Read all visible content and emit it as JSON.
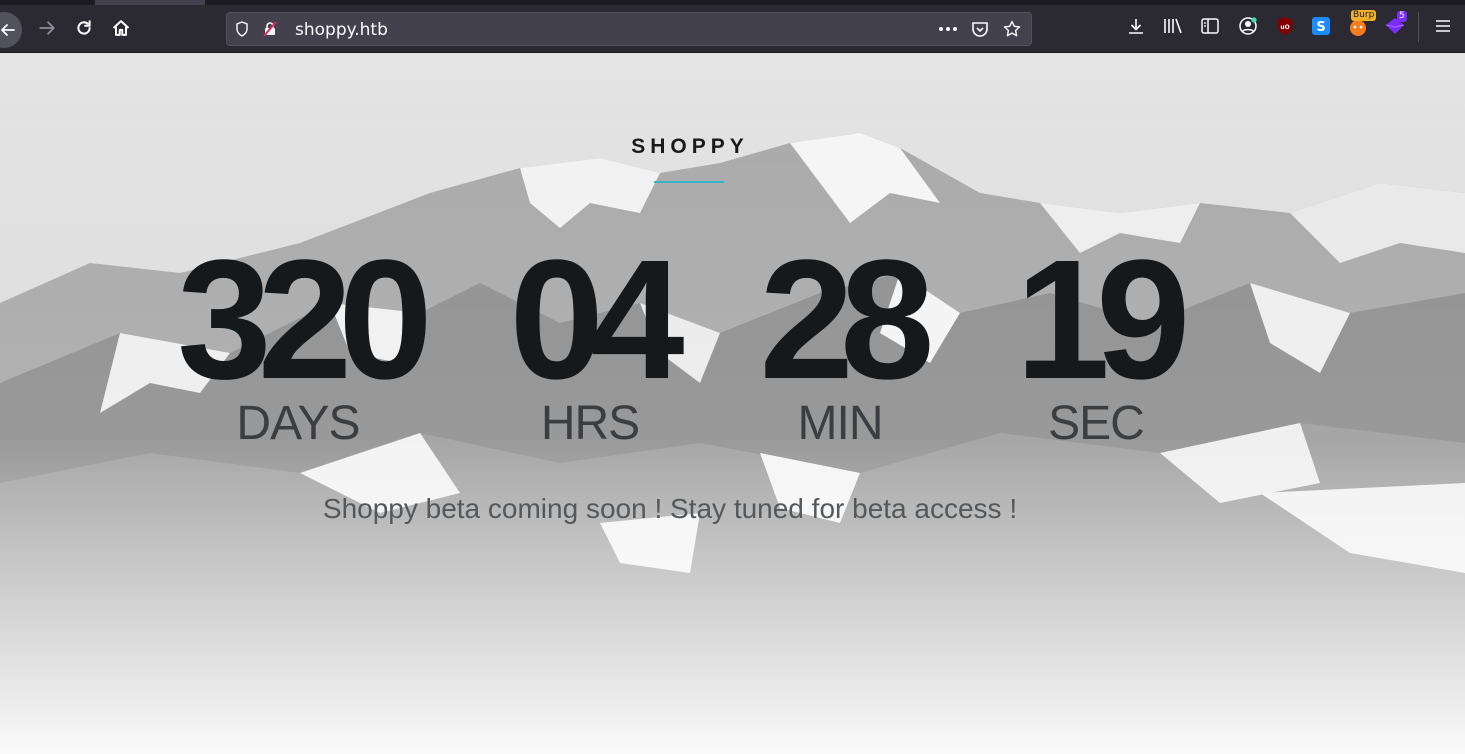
{
  "browser": {
    "url": "shoppy.htb",
    "extensions": {
      "burp_badge": "Burp",
      "notification_count": "5"
    }
  },
  "page": {
    "brand": "SHOPPY",
    "countdown": [
      {
        "value": "320",
        "unit": "DAYS"
      },
      {
        "value": "04",
        "unit": "HRS"
      },
      {
        "value": "28",
        "unit": "MIN"
      },
      {
        "value": "19",
        "unit": "SEC"
      }
    ],
    "tagline": "Shoppy beta coming soon ! Stay tuned for beta access !"
  },
  "colors": {
    "toolbar": "#2b2a33",
    "urlbar": "#42414d",
    "accent_rule": "#3bb0c9",
    "digits": "#16191b"
  }
}
